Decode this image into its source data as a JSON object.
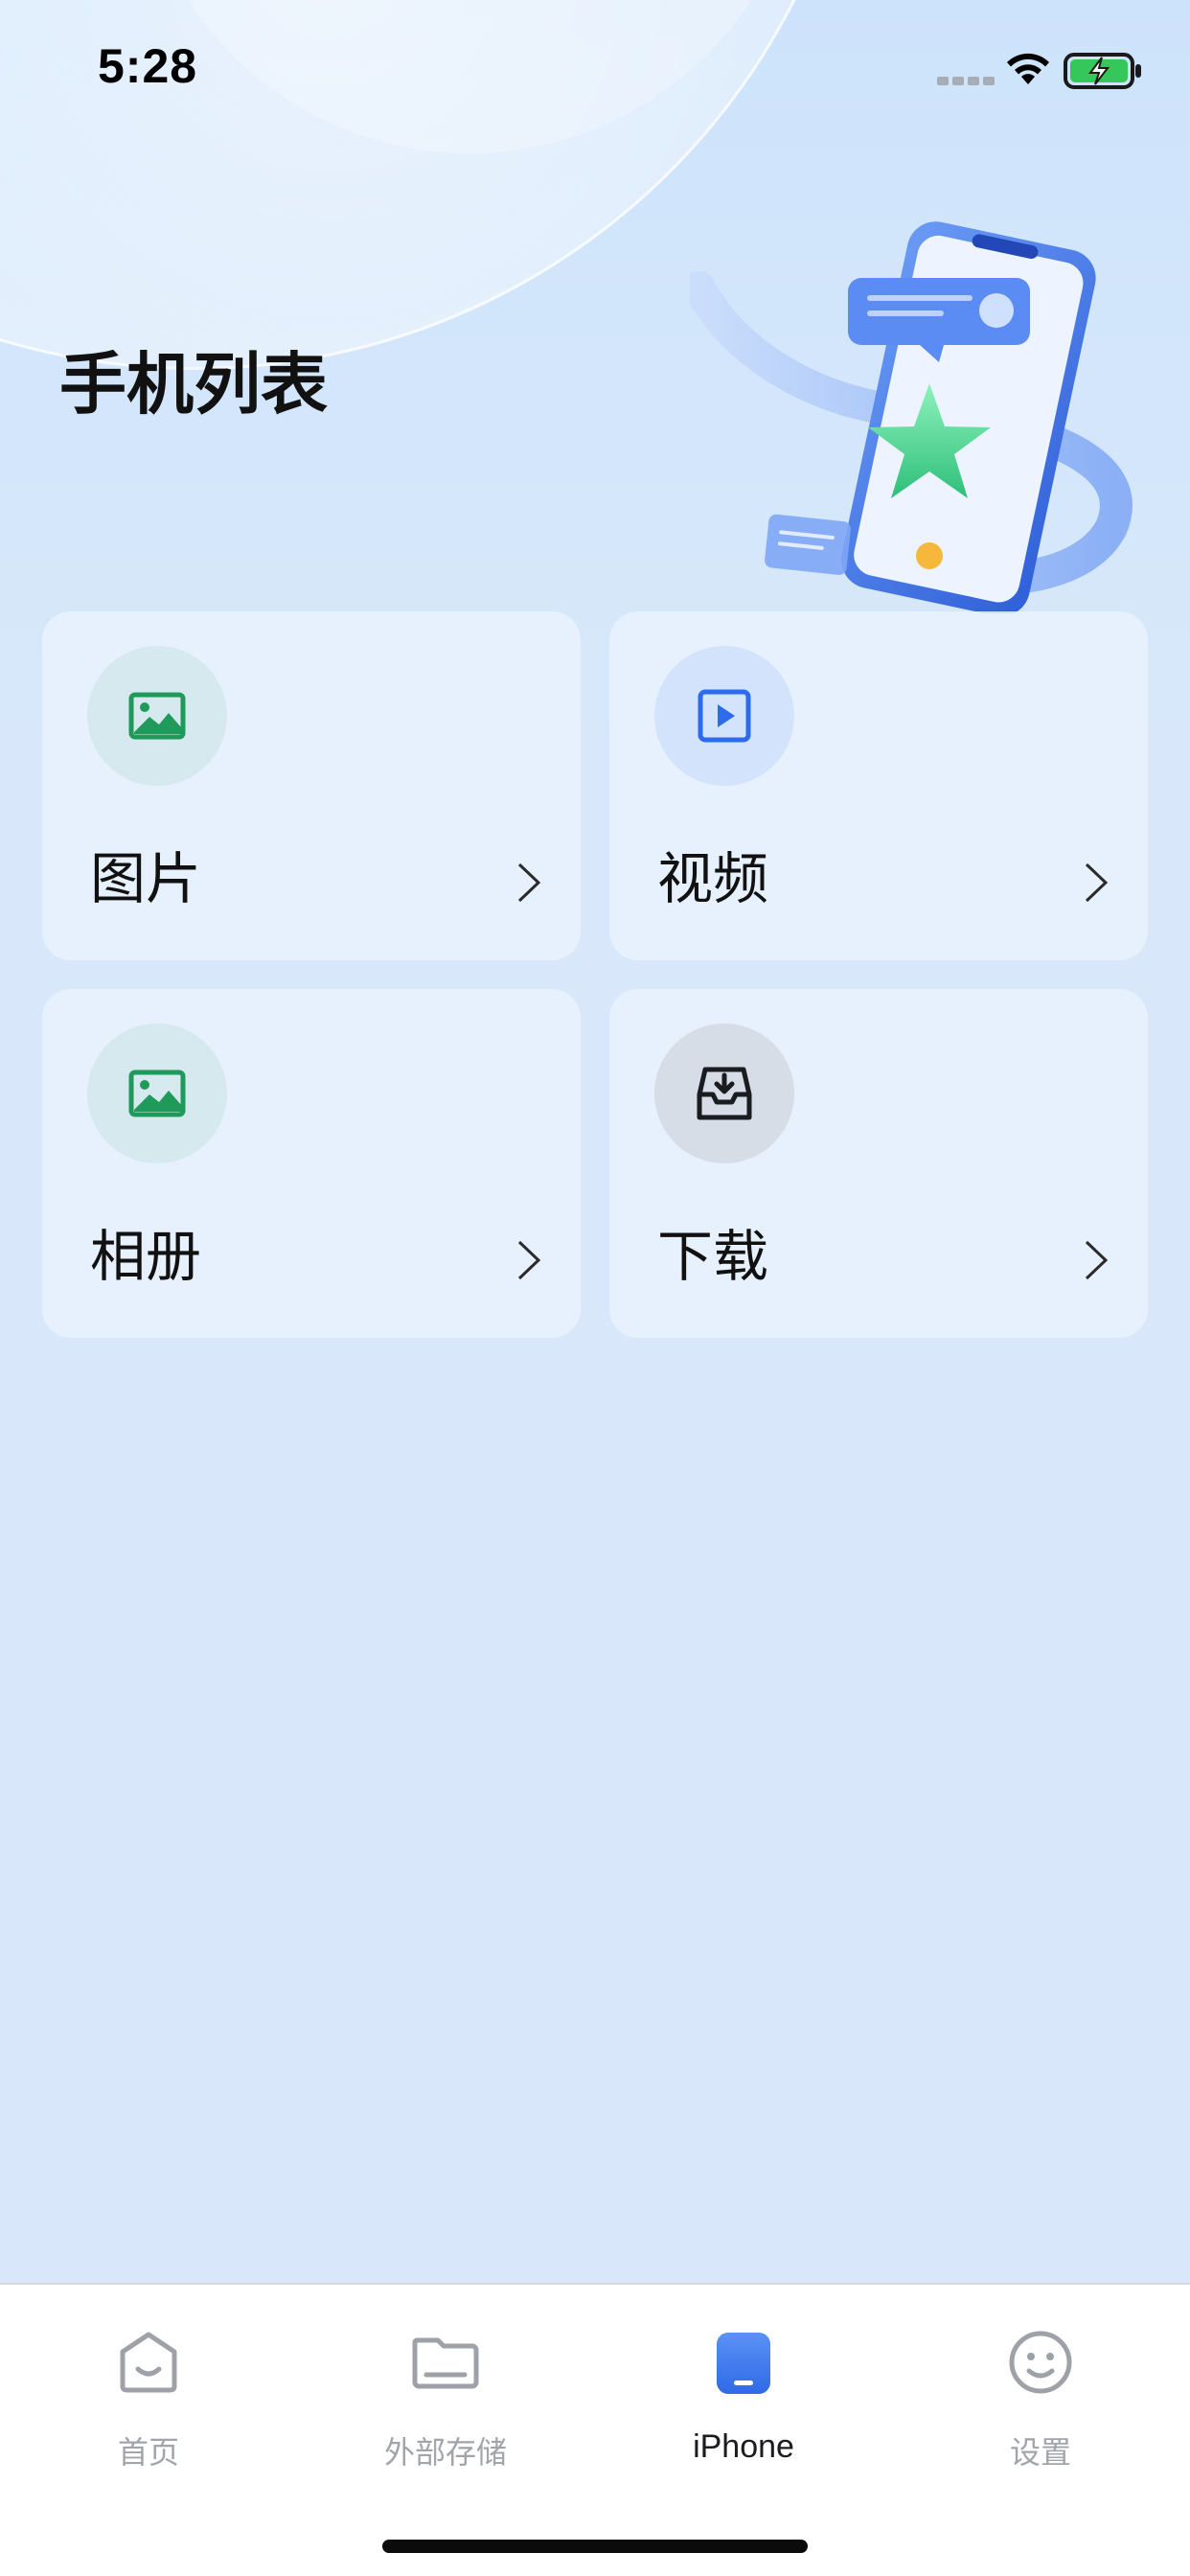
{
  "status_bar": {
    "time": "5:28"
  },
  "header": {
    "title": "手机列表"
  },
  "grid": {
    "items": [
      {
        "label": "图片",
        "icon": "image-icon",
        "accent": "#1f9a5b",
        "circle": "#d5e9ee"
      },
      {
        "label": "视频",
        "icon": "video-icon",
        "accent": "#2e6bea",
        "circle": "#d2e3fb"
      },
      {
        "label": "相册",
        "icon": "album-icon",
        "accent": "#1f9a5b",
        "circle": "#d5e9ee"
      },
      {
        "label": "下载",
        "icon": "download-inbox-icon",
        "accent": "#1b1c1f",
        "circle": "#d6dde6"
      }
    ]
  },
  "tab_bar": {
    "tabs": [
      {
        "label": "首页",
        "icon": "home-icon",
        "active": false
      },
      {
        "label": "外部存储",
        "icon": "folder-icon",
        "active": false
      },
      {
        "label": "iPhone",
        "icon": "iphone-icon",
        "active": true
      },
      {
        "label": "设置",
        "icon": "smiley-settings-icon",
        "active": false
      }
    ]
  },
  "colors": {
    "accent_blue": "#3d7cf0",
    "inactive_tab": "#a1a4aa",
    "background": "#d8e8fa"
  }
}
